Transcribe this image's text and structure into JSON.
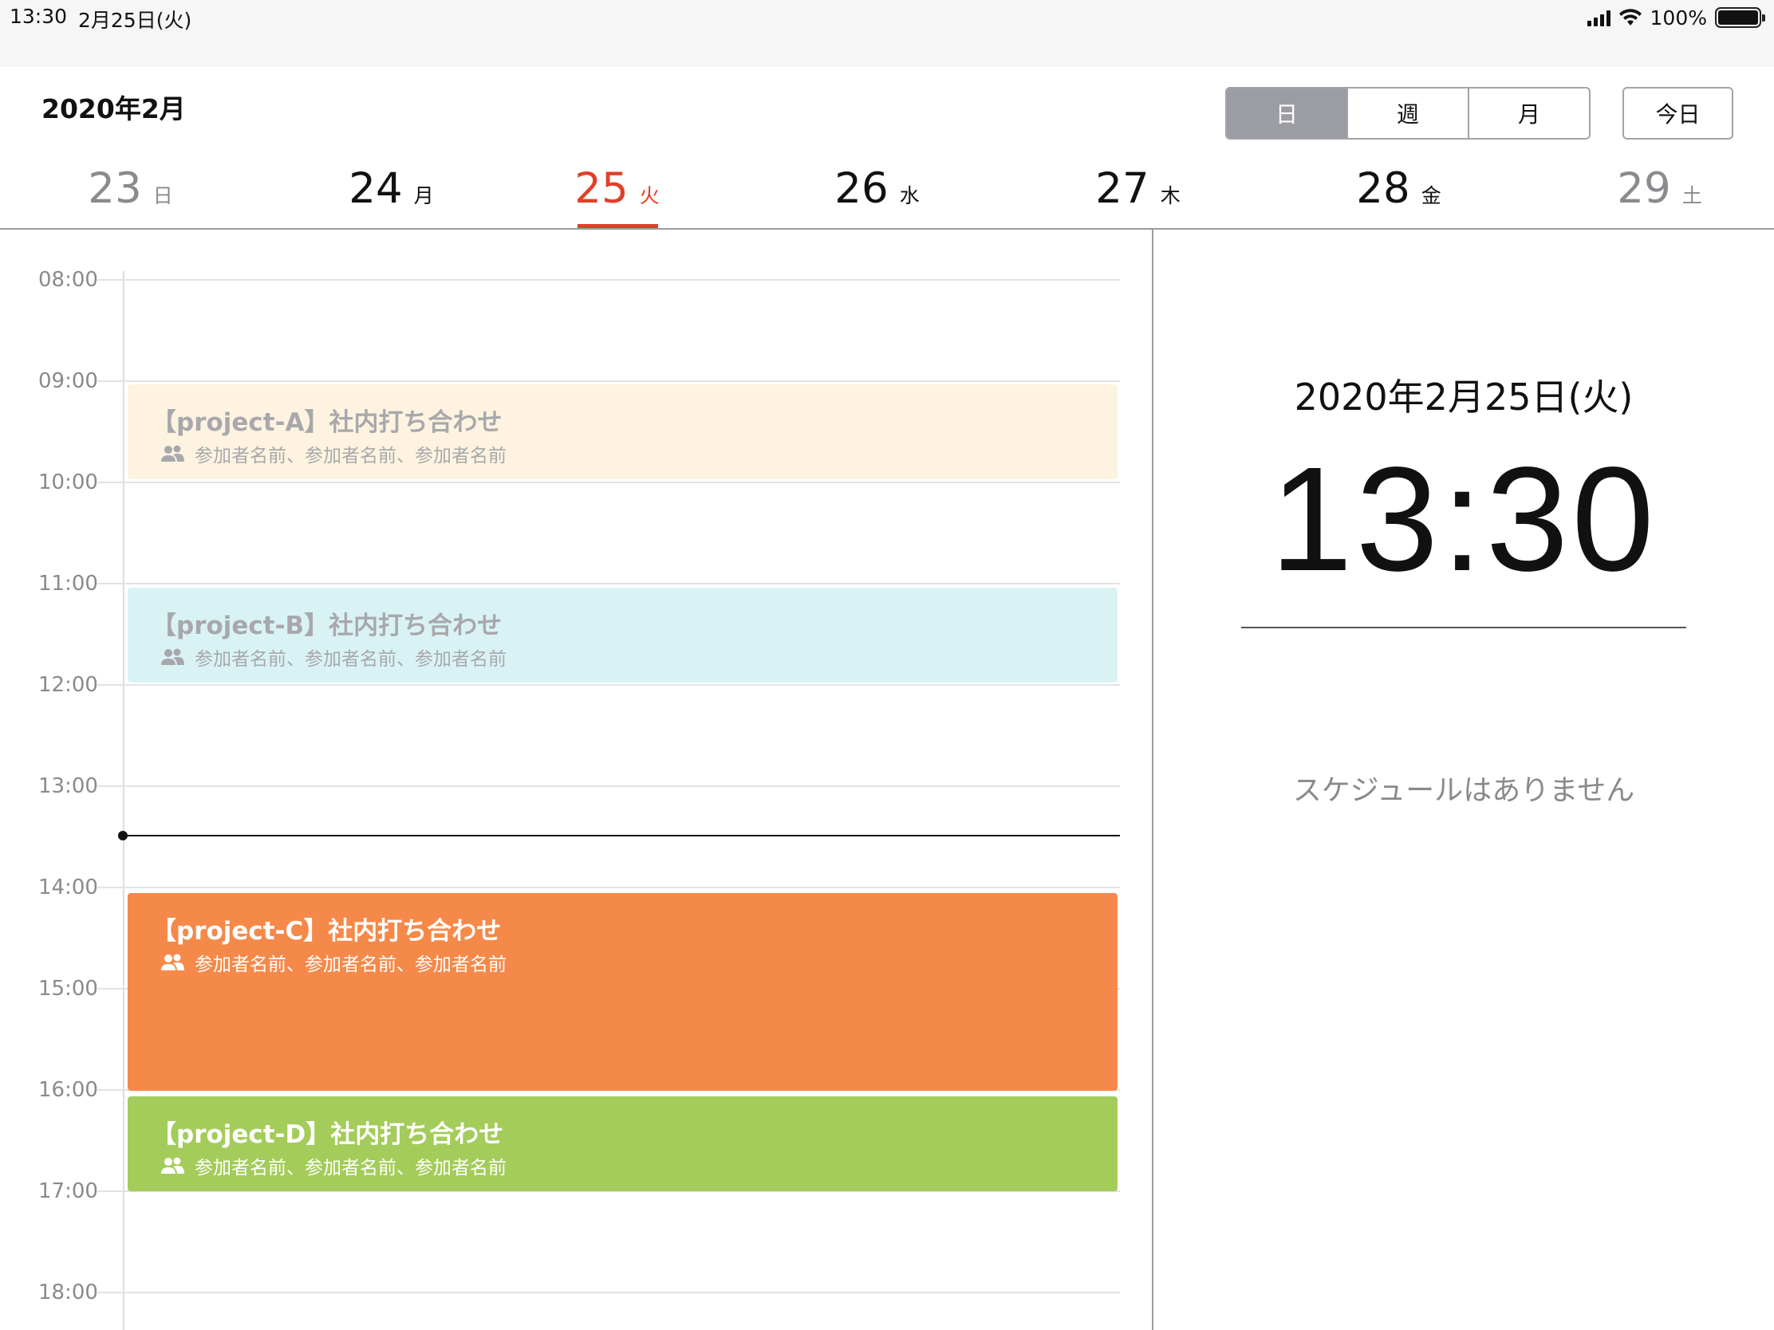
{
  "status_bar": {
    "time": "13:30",
    "date": "2月25日(火)",
    "battery": "100%",
    "icons": [
      "signal-icon",
      "wifi-icon",
      "battery-icon"
    ]
  },
  "header": {
    "month_title": "2020年2月",
    "views": [
      "日",
      "週",
      "月"
    ],
    "active_view": "日",
    "today_label": "今日"
  },
  "week": [
    {
      "num": "23",
      "wd": "日",
      "state": "weekend"
    },
    {
      "num": "24",
      "wd": "月",
      "state": "normal"
    },
    {
      "num": "25",
      "wd": "火",
      "state": "selected"
    },
    {
      "num": "26",
      "wd": "水",
      "state": "normal"
    },
    {
      "num": "27",
      "wd": "木",
      "state": "normal"
    },
    {
      "num": "28",
      "wd": "金",
      "state": "normal"
    },
    {
      "num": "29",
      "wd": "土",
      "state": "weekend"
    }
  ],
  "timeline": {
    "hours": [
      "08:00",
      "09:00",
      "10:00",
      "11:00",
      "12:00",
      "13:00",
      "14:00",
      "15:00",
      "16:00",
      "17:00",
      "18:00"
    ],
    "current_time": "13:30",
    "events": [
      {
        "title": "【project-A】社内打ち合わせ",
        "attendees": "参加者名前、参加者名前、参加者名前",
        "start": "09:00",
        "end": "10:00",
        "color": "#fdf3e0",
        "style": "past"
      },
      {
        "title": "【project-B】社内打ち合わせ",
        "attendees": "参加者名前、参加者名前、参加者名前",
        "start": "11:00",
        "end": "12:00",
        "color": "#d9f3f5",
        "style": "past"
      },
      {
        "title": "【project-C】社内打ち合わせ",
        "attendees": "参加者名前、参加者名前、参加者名前",
        "start": "14:00",
        "end": "16:00",
        "color": "#f5894a",
        "style": "upcoming"
      },
      {
        "title": "【project-D】社内打ち合わせ",
        "attendees": "参加者名前、参加者名前、参加者名前",
        "start": "16:00",
        "end": "17:00",
        "color": "#a3cc5a",
        "style": "upcoming"
      }
    ]
  },
  "detail": {
    "date": "2020年2月25日(火)",
    "clock": "13:30",
    "empty_message": "スケジュールはありません"
  },
  "colors": {
    "accent_red": "#e0402a",
    "segment_active": "#9c9ca3",
    "muted_text": "#8a8a8e"
  }
}
